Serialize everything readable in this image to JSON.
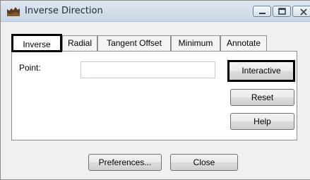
{
  "window": {
    "title": "Inverse Direction",
    "icon": "app-icon"
  },
  "tabs": [
    {
      "label": "Inverse",
      "active": true
    },
    {
      "label": "Radial",
      "active": false
    },
    {
      "label": "Tangent Offset",
      "active": false
    },
    {
      "label": "Minimum",
      "active": false
    },
    {
      "label": "Annotate",
      "active": false
    }
  ],
  "form": {
    "point_label": "Point:",
    "point_value": ""
  },
  "side_buttons": {
    "interactive": "Interactive",
    "reset": "Reset",
    "help": "Help"
  },
  "footer": {
    "preferences": "Preferences...",
    "close": "Close"
  }
}
